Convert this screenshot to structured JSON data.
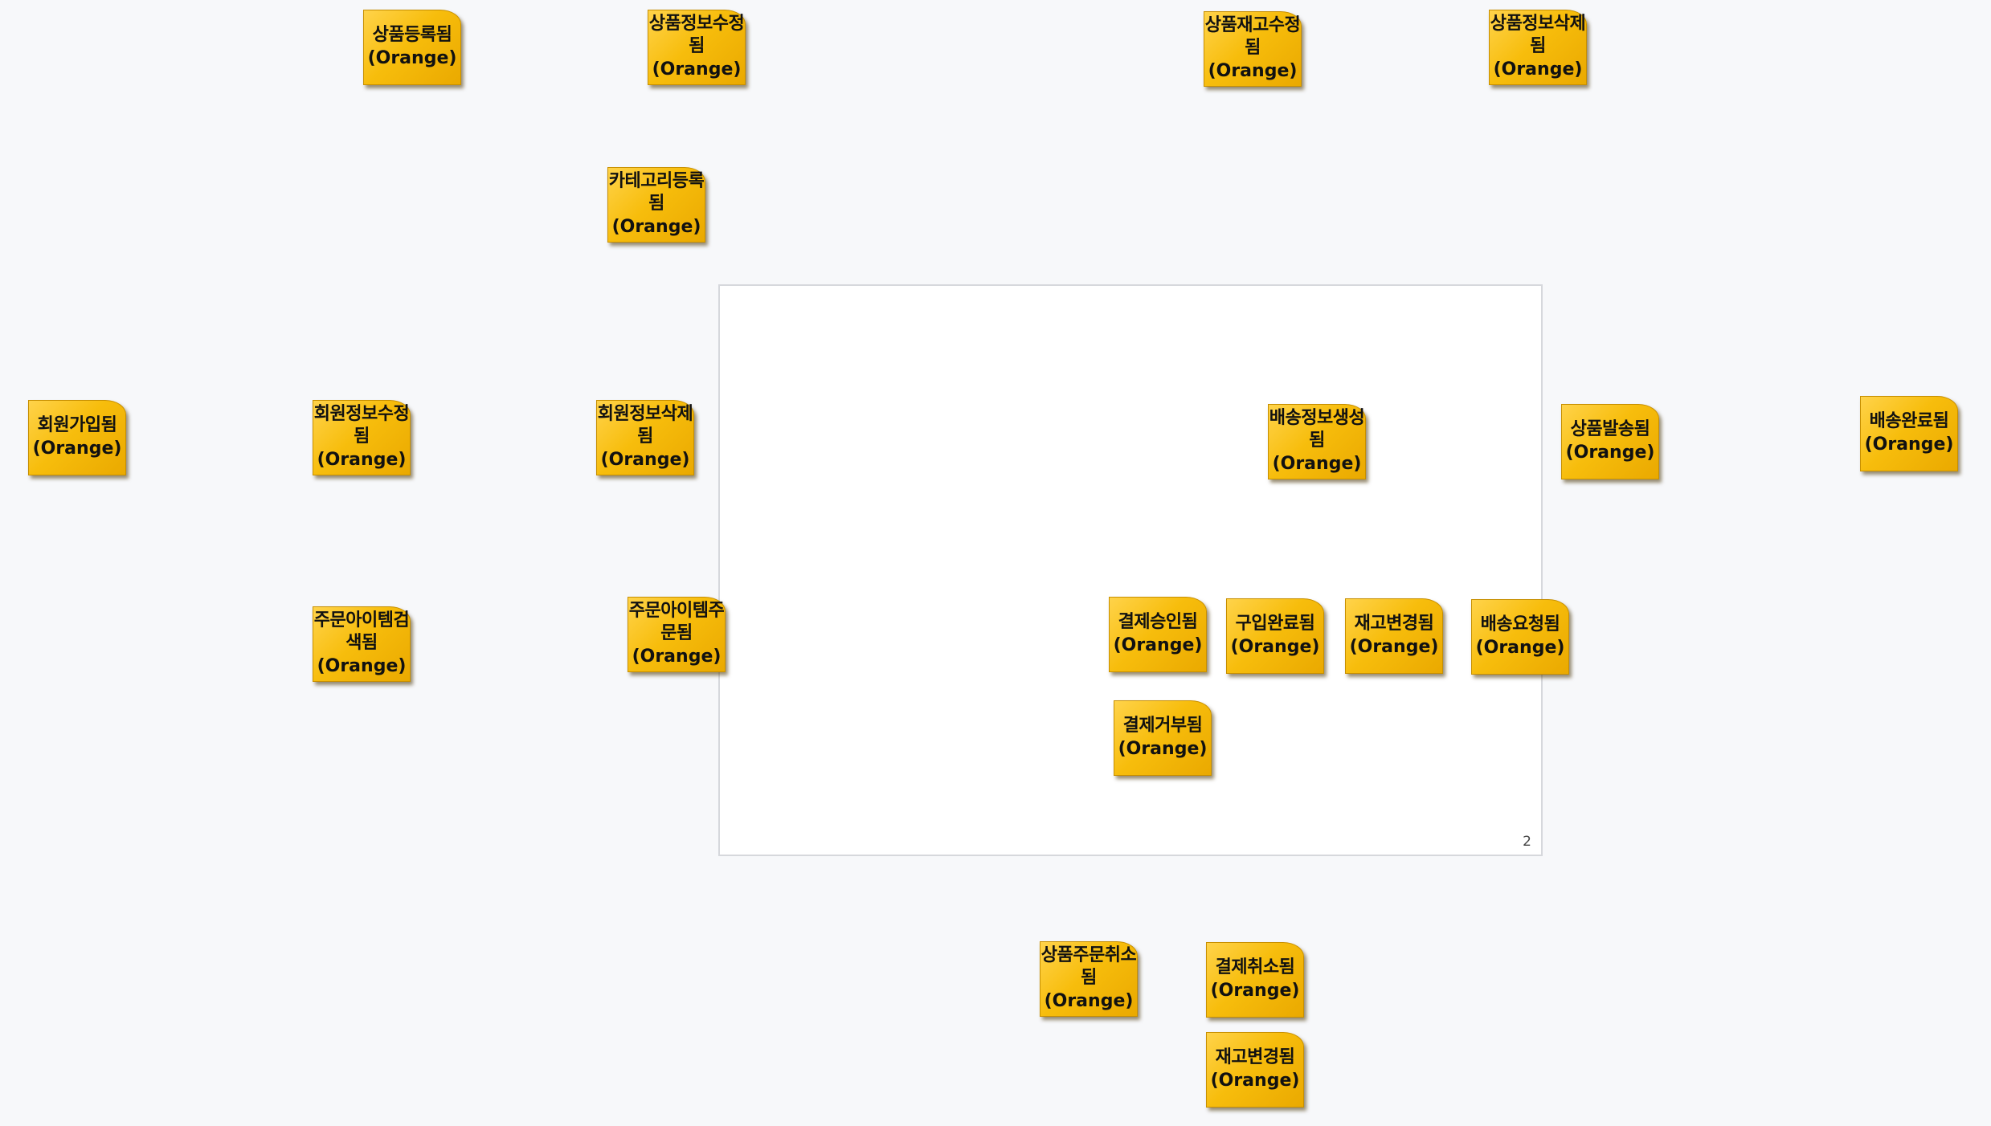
{
  "board": {
    "page_number": "2",
    "sticky_color": "#f5bb0c"
  },
  "notes": [
    {
      "label": "상품등록됨",
      "type": "(Orange)"
    },
    {
      "label": "상품정보수정됨",
      "type": "(Orange)"
    },
    {
      "label": "상품재고수정됨",
      "type": "(Orange)"
    },
    {
      "label": "상품정보삭제됨",
      "type": "(Orange)"
    },
    {
      "label": "카테고리등록됨",
      "type": "(Orange)"
    },
    {
      "label": "회원가입됨",
      "type": "(Orange)"
    },
    {
      "label": "회원정보수정됨",
      "type": "(Orange)"
    },
    {
      "label": "회원정보삭제됨",
      "type": "(Orange)"
    },
    {
      "label": "배송정보생성됨",
      "type": "(Orange)"
    },
    {
      "label": "상품발송됨",
      "type": "(Orange)"
    },
    {
      "label": "배송완료됨",
      "type": "(Orange)"
    },
    {
      "label": "주문아이템검색됨",
      "type": "(Orange)"
    },
    {
      "label": "주문아이템주문됨",
      "type": "(Orange)"
    },
    {
      "label": "결제승인됨",
      "type": "(Orange)"
    },
    {
      "label": "구입완료됨",
      "type": "(Orange)"
    },
    {
      "label": "재고변경됨",
      "type": "(Orange)"
    },
    {
      "label": "배송요청됨",
      "type": "(Orange)"
    },
    {
      "label": "결제거부됨",
      "type": "(Orange)"
    },
    {
      "label": "상품주문취소됨",
      "type": "(Orange)"
    },
    {
      "label": "결제취소됨",
      "type": "(Orange)"
    },
    {
      "label": "재고변경됨",
      "type": "(Orange)"
    }
  ]
}
